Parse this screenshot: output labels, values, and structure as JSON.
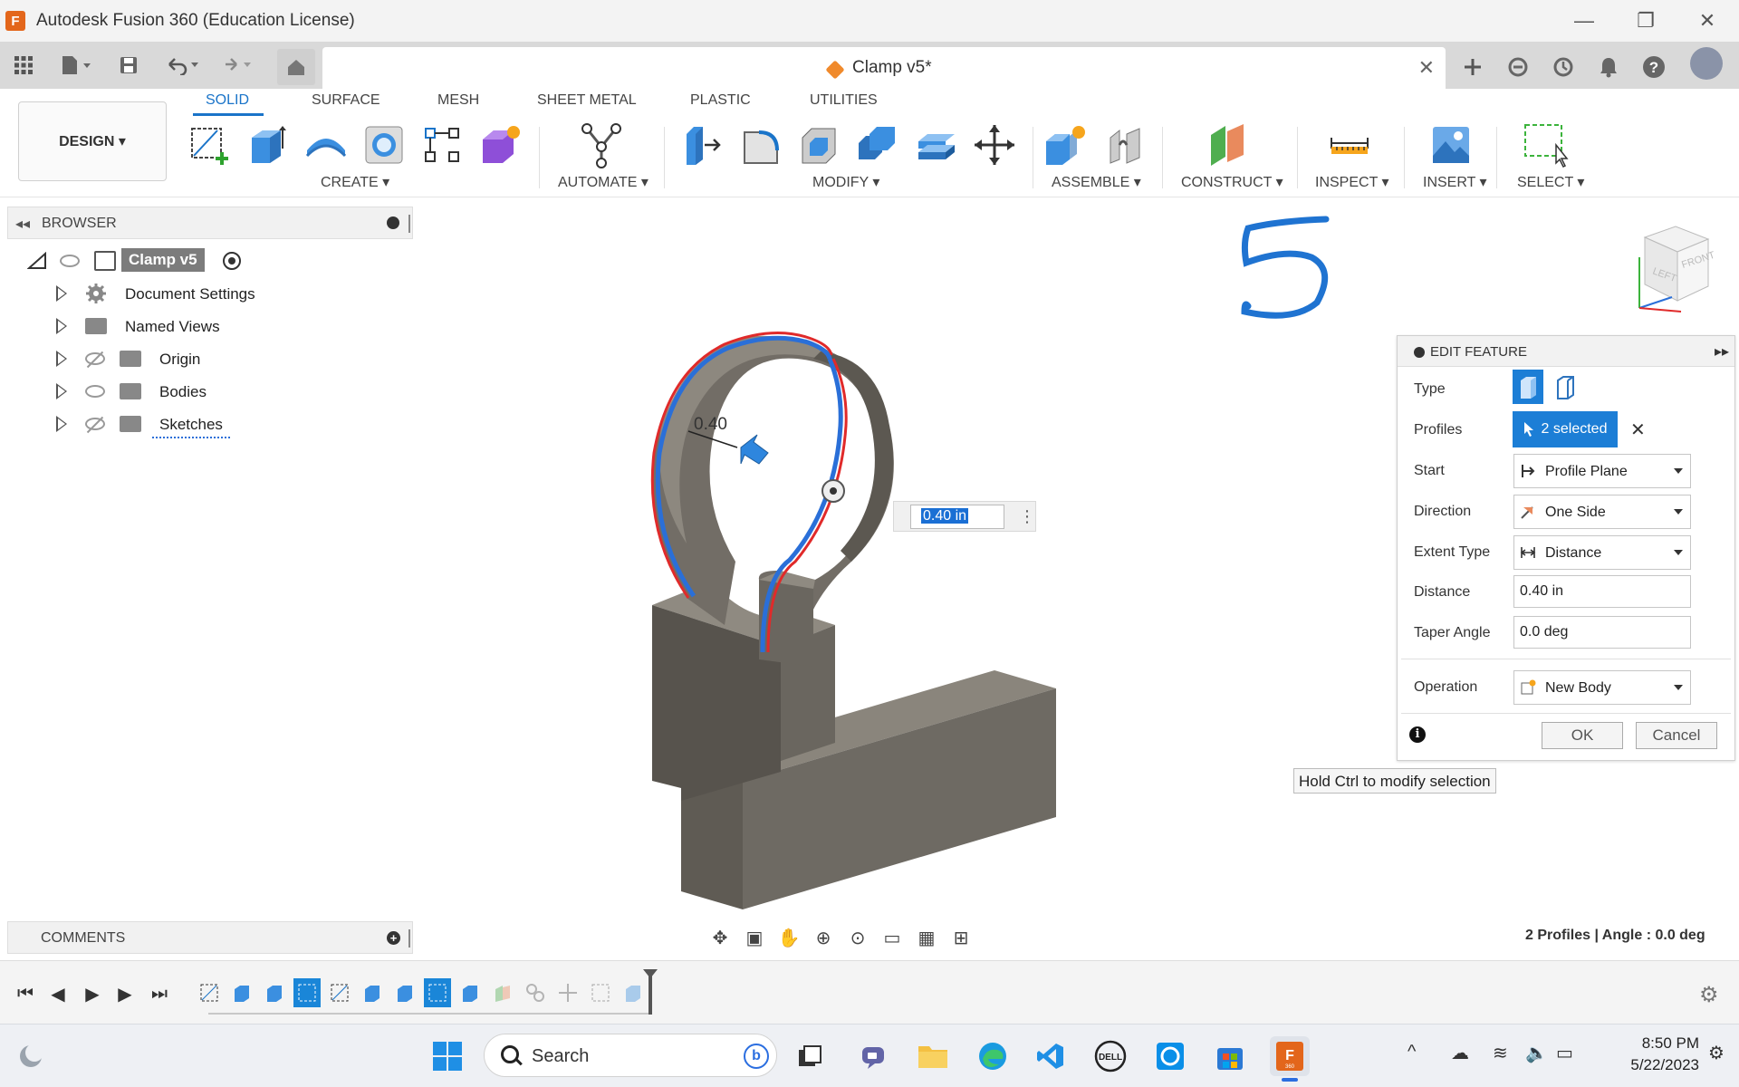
{
  "window": {
    "title": "Autodesk Fusion 360 (Education License)",
    "minimize_glyph": "—",
    "maximize_glyph": "❐",
    "close_glyph": "✕"
  },
  "doc_tab": {
    "name": "Clamp v5*",
    "close": "✕"
  },
  "workspace": {
    "label": "DESIGN ▾"
  },
  "ribbon_tabs": [
    "SOLID",
    "SURFACE",
    "MESH",
    "SHEET METAL",
    "PLASTIC",
    "UTILITIES"
  ],
  "ribbon_groups": {
    "create": "CREATE ▾",
    "automate": "AUTOMATE ▾",
    "modify": "MODIFY ▾",
    "assemble": "ASSEMBLE ▾",
    "construct": "CONSTRUCT ▾",
    "inspect": "INSPECT ▾",
    "insert": "INSERT ▾",
    "select": "SELECT ▾"
  },
  "browser": {
    "title": "BROWSER",
    "root": "Clamp v5",
    "items": [
      "Document Settings",
      "Named Views",
      "Origin",
      "Bodies",
      "Sketches"
    ]
  },
  "comments": {
    "title": "COMMENTS",
    "add": "+"
  },
  "viewport": {
    "dimension_label": "0.40",
    "distance_input": "0.40 in",
    "annotation": "5"
  },
  "edit_feature": {
    "title": "EDIT FEATURE",
    "labels": {
      "type": "Type",
      "profiles": "Profiles",
      "start": "Start",
      "direction": "Direction",
      "extent_type": "Extent Type",
      "distance": "Distance",
      "taper_angle": "Taper Angle",
      "operation": "Operation"
    },
    "profiles_value": "2 selected",
    "start_value": "Profile Plane",
    "direction_value": "One Side",
    "extent_type_value": "Distance",
    "distance_value": "0.40 in",
    "taper_angle_value": "0.0 deg",
    "operation_value": "New Body",
    "ok": "OK",
    "cancel": "Cancel"
  },
  "tooltip": "Hold Ctrl to modify selection",
  "status": "2 Profiles | Angle : 0.0 deg",
  "taskbar": {
    "search_placeholder": "Search",
    "time": "8:50 PM",
    "date": "5/22/2023"
  },
  "colors": {
    "accent": "#1a74c9",
    "selected_button": "#1c7ed6",
    "body": "#6e6a63",
    "profile_red": "#e02a2a",
    "profile_blue": "#2a6fd8",
    "annotation_blue": "#1f73d1"
  }
}
